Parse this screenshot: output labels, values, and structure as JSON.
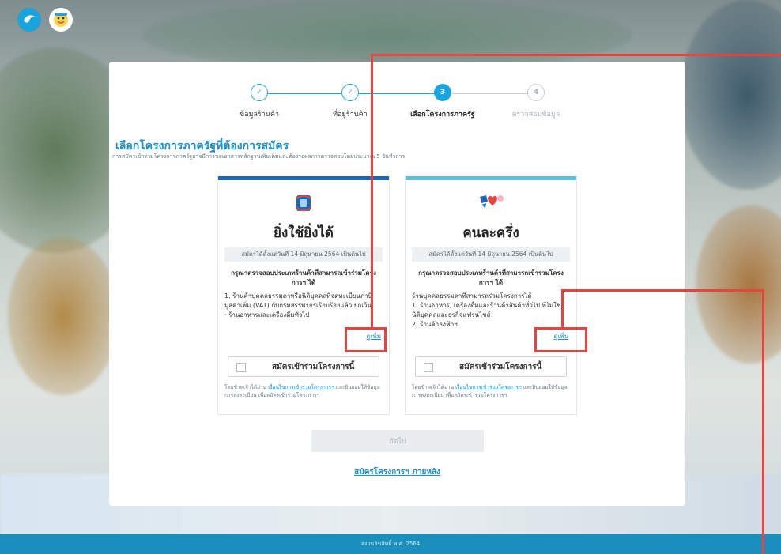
{
  "brand": {
    "logo_bank_icon": "ktb-bird-icon",
    "logo_program_icon": "mascot-icon"
  },
  "stepper": {
    "steps": [
      {
        "number": "1",
        "label": "ข้อมูลร้านค้า",
        "state": "done"
      },
      {
        "number": "2",
        "label": "ที่อยู่ร้านค้า",
        "state": "done"
      },
      {
        "number": "3",
        "label": "เลือกโครงการภาครัฐ",
        "state": "active"
      },
      {
        "number": "4",
        "label": "ตรวจสอบข้อมูล",
        "state": "todo"
      }
    ]
  },
  "section": {
    "title": "เลือกโครงการภาครัฐที่ต้องการสมัคร",
    "subtitle": "การสมัครเข้าร่วมโครงการภาครัฐอาจมีการขอเอกสารหลักฐานเพิ่มเติมและต้องรอผลการตรวจสอบโดยประมาณ 5 วันทำการ"
  },
  "programs": [
    {
      "name": "ยิ่งใช้ยิ่งได้",
      "date": "สมัครได้ตั้งแต่วันที่ 14 มิถุนายน 2564 เป็นต้นไป",
      "check": "กรุณาตรวจสอบประเภทร้านค้าที่สามารถเข้าร่วมโครงการฯ ได้",
      "desc": "1. ร้านค้าบุคคลธรรมดาหรือนิติบุคคลที่จดทะเบียนภาษีมูลค่าเพิ่ม (VAT) กับกรมสรรพากรเรียบร้อยแล้ว ยกเว้น\n · ร้านอาหารและเครื่องดื่มทั่วไป",
      "more": "ดูเพิ่ม",
      "apply": "สมัครเข้าร่วมโครงการนี้",
      "consent_pre": "โดยข้าพเจ้าได้อ่าน ",
      "consent_link": "เงื่อนไขการเข้าร่วมโครงการฯ",
      "consent_post": " และยินยอมให้ข้อมูลการลงทะเบียน เพื่อสมัครเข้าร่วมโครงการฯ"
    },
    {
      "name": "คนละครึ่ง",
      "date": "สมัครได้ตั้งแต่วันที่ 14 มิถุนายน 2564 เป็นต้นไป",
      "check": "กรุณาตรวจสอบประเภทร้านค้าที่สามารถเข้าร่วมโครงการฯ ได้",
      "desc": "ร้านบุคคลธรรมดาที่สามารถร่วมโครงการได้\n1. ร้านอาหาร, เครื่องดื่มและร้านค้าสินค้าทั่วไป ที่ไม่ใช่นิติบุคคลและธุรกิจแฟรนไชส์\n2. ร้านค้าธงฟ้าฯ",
      "more": "ดูเพิ่ม",
      "apply": "สมัครเข้าร่วมโครงการนี้",
      "consent_pre": "โดยข้าพเจ้าได้อ่าน ",
      "consent_link": "เงื่อนไขการเข้าร่วมโครงการฯ",
      "consent_post": " และยินยอมให้ข้อมูลการลงทะเบียน เพื่อสมัครเข้าร่วมโครงการฯ"
    }
  ],
  "actions": {
    "next": "ถัดไป",
    "later": "สมัครโครงการฯ ภายหลัง"
  },
  "footer": {
    "copyright": "สงวนลิขสิทธิ์ พ.ศ. 2564"
  },
  "colors": {
    "primary": "#1a8fc8",
    "accent": "#1ba5dd",
    "highlight": "#e8433f",
    "card1_bar": "#1f66b8",
    "card2_bar": "#5cc1d8",
    "footer": "#1a8fbd"
  }
}
